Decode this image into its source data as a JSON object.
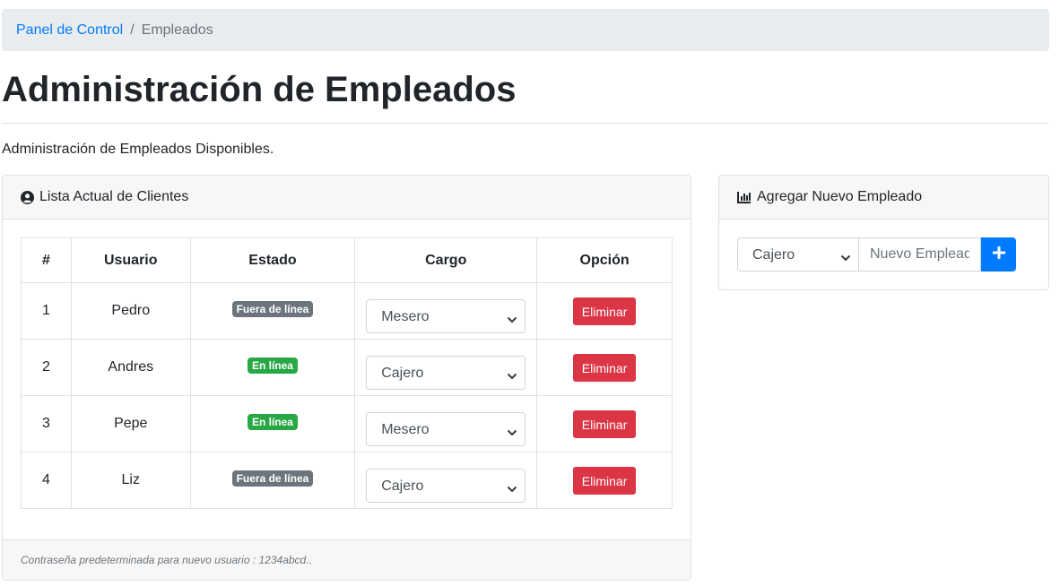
{
  "breadcrumb": {
    "home": "Panel de Control",
    "separator": "/",
    "current": "Empleados"
  },
  "page": {
    "title": "Administración de Empleados",
    "subtitle": "Administración de Empleados Disponibles."
  },
  "employees_card": {
    "header_icon": "user-circle-icon",
    "header": "Lista Actual de Clientes",
    "columns": [
      "#",
      "Usuario",
      "Estado",
      "Cargo",
      "Opción"
    ],
    "rows": [
      {
        "num": "1",
        "user": "Pedro",
        "status": "Fuera de línea",
        "status_kind": "offline",
        "role": "Mesero",
        "action": "Eliminar"
      },
      {
        "num": "2",
        "user": "Andres",
        "status": "En línea",
        "status_kind": "online",
        "role": "Cajero",
        "action": "Eliminar"
      },
      {
        "num": "3",
        "user": "Pepe",
        "status": "En línea",
        "status_kind": "online",
        "role": "Mesero",
        "action": "Eliminar"
      },
      {
        "num": "4",
        "user": "Liz",
        "status": "Fuera de línea",
        "status_kind": "offline",
        "role": "Cajero",
        "action": "Eliminar"
      }
    ],
    "footer": "Contraseña predeterminada para nuevo usuario : 1234abcd.."
  },
  "add_card": {
    "header_icon": "bar-chart-icon",
    "header": "Agregar Nuevo Empleado",
    "role_selected": "Cajero",
    "name_placeholder": "Nuevo Empleado",
    "add_icon": "plus-icon"
  },
  "colors": {
    "primary": "#007bff",
    "danger": "#dc3545",
    "success": "#28a745",
    "secondary": "#6c757d"
  }
}
